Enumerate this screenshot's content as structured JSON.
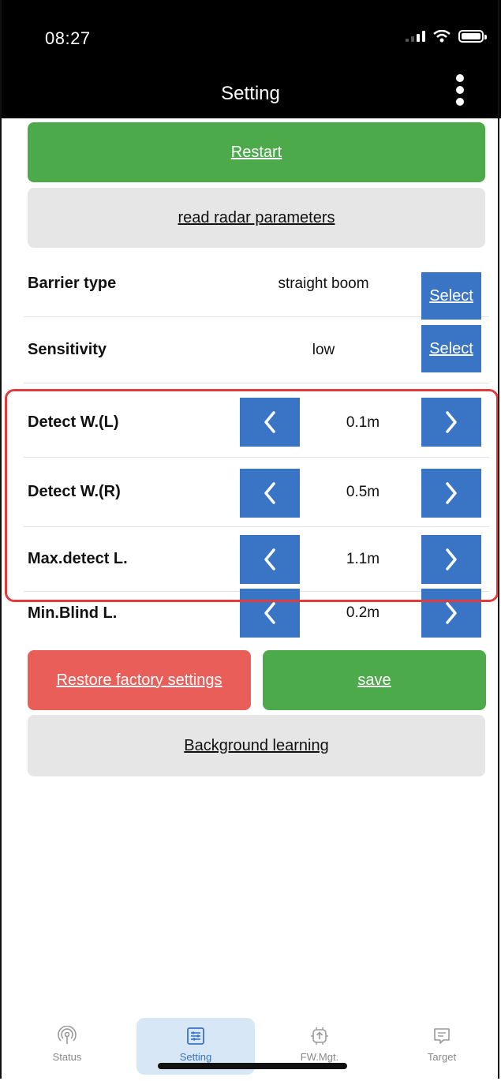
{
  "status_bar": {
    "time": "08:27"
  },
  "header": {
    "title": "Setting"
  },
  "buttons": {
    "restart": "Restart",
    "read_params": "read radar parameters",
    "restore": "Restore factory settings",
    "save": "save",
    "background": "Background learning"
  },
  "select_rows": [
    {
      "label": "Barrier type",
      "value": "straight boom",
      "button": "Select"
    },
    {
      "label": "Sensitivity",
      "value": "low",
      "button": "Select"
    }
  ],
  "stepper_rows": [
    {
      "label": "Detect W.(L)",
      "value": "0.1m"
    },
    {
      "label": "Detect W.(R)",
      "value": "0.5m"
    },
    {
      "label": "Max.detect L.",
      "value": "1.1m"
    },
    {
      "label": "Min.Blind L.",
      "value": "0.2m"
    }
  ],
  "tabs": [
    {
      "label": "Status",
      "icon": "radar-icon"
    },
    {
      "label": "Setting",
      "icon": "settings-list-icon",
      "active": true
    },
    {
      "label": "FW.Mgt.",
      "icon": "chip-upload-icon"
    },
    {
      "label": "Target",
      "icon": "message-icon"
    }
  ],
  "colors": {
    "green": "#4caa4a",
    "blue": "#3a74c4",
    "red": "#ea5e59",
    "highlight": "#e23b3b"
  }
}
